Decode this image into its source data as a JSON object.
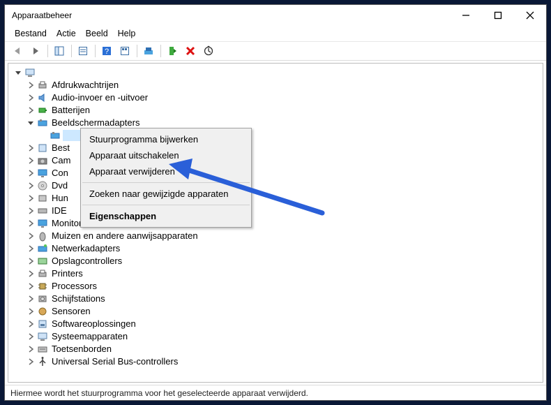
{
  "window": {
    "title": "Apparaatbeheer"
  },
  "menu": {
    "file": "Bestand",
    "action": "Actie",
    "view": "Beeld",
    "help": "Help"
  },
  "tree": {
    "root": "",
    "items": [
      "Afdrukwachtrijen",
      "Audio-invoer en -uitvoer",
      "Batterijen",
      "Beeldschermadapters",
      "",
      "Best",
      "Cam",
      "Con",
      "Dvd",
      "Hun",
      "IDE",
      "Monitors",
      "Muizen en andere aanwijsapparaten",
      "Netwerkadapters",
      "Opslagcontrollers",
      "Printers",
      "Processors",
      "Schijfstations",
      "Sensoren",
      "Softwareoplossingen",
      "Systeemapparaten",
      "Toetsenborden",
      "Universal Serial Bus-controllers"
    ]
  },
  "context": {
    "update": "Stuurprogramma bijwerken",
    "disable": "Apparaat uitschakelen",
    "remove": "Apparaat verwijderen",
    "scan": "Zoeken naar gewijzigde apparaten",
    "props": "Eigenschappen"
  },
  "status": "Hiermee wordt het stuurprogramma voor het geselecteerde apparaat verwijderd."
}
